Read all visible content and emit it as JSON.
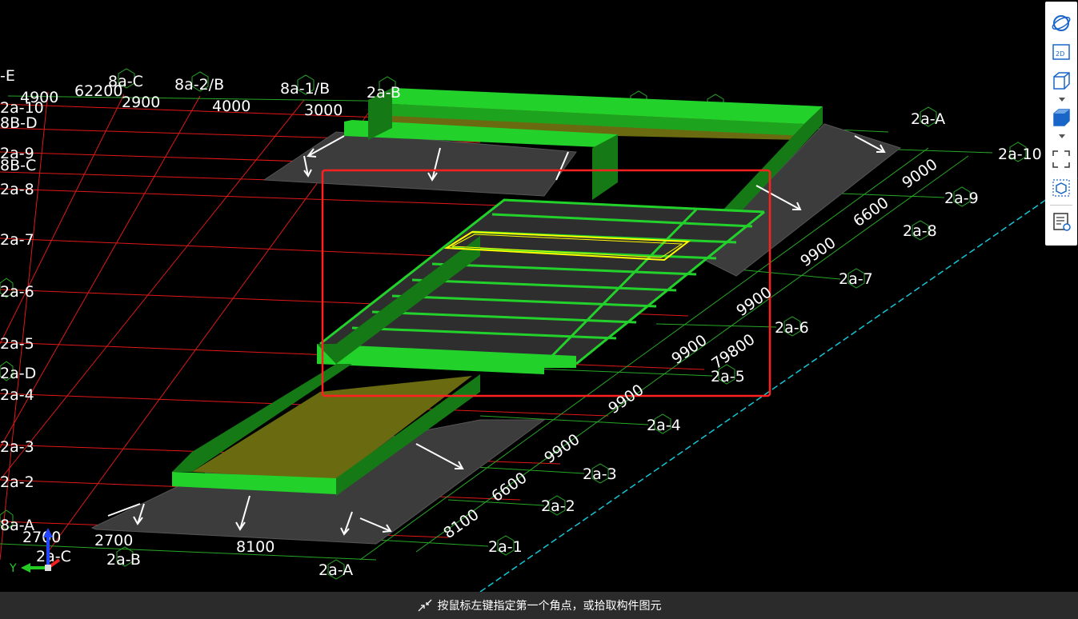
{
  "viewport": {
    "axis_labels_left": [
      "-E",
      "2a-10",
      "8B-D",
      "2a-9",
      "8B-C",
      "2a-8",
      "2a-7",
      "2a-6",
      "2a-5",
      "2a-D",
      "2a-4",
      "2a-3",
      "2a-2",
      "8a-A"
    ],
    "axis_labels_top": [
      "8a-C",
      "8a-2/B",
      "8a-1/B",
      "2a-B"
    ],
    "axis_labels_right": [
      "2a-A",
      "2a-10",
      "2a-9",
      "2a-8",
      "2a-7",
      "2a-6",
      "2a-5",
      "2a-4",
      "2a-3",
      "2a-2",
      "2a-1"
    ],
    "axis_labels_bottom": [
      "2a-C",
      "2a-B",
      "2a-A"
    ],
    "dims_top": [
      "4900",
      "62200",
      "2900",
      "4000",
      "3000"
    ],
    "dims_right": [
      "9000",
      "6600",
      "9900",
      "9900",
      "9900",
      "79800",
      "9900",
      "9900",
      "6600",
      "8100"
    ],
    "dims_bottom": [
      "2700",
      "2700",
      "8100"
    ],
    "colors": {
      "grid_red": "#e01818",
      "grid_green": "#27a827",
      "beam_green": "#22d22b",
      "beam_dark": "#157a15",
      "wall_olive": "#6a6a10",
      "slab_gray": "#3c3c3c",
      "selection_red": "#ff2020",
      "highlight_yellow": "#ffff00",
      "ground_cyan": "#16c6d6"
    }
  },
  "toolbar": {
    "items": [
      {
        "name": "orbit-icon"
      },
      {
        "name": "2d-view-icon",
        "label": "2D"
      },
      {
        "name": "3d-view-icon"
      },
      {
        "name": "solid-view-icon"
      },
      {
        "name": "zoom-extents-icon"
      },
      {
        "name": "box-select-icon"
      },
      {
        "name": "properties-icon"
      }
    ]
  },
  "axes_gizmo": {
    "y_label": "Y"
  },
  "status": {
    "hint_text": "按鼠标左键指定第一个角点，或拾取构件图元"
  }
}
